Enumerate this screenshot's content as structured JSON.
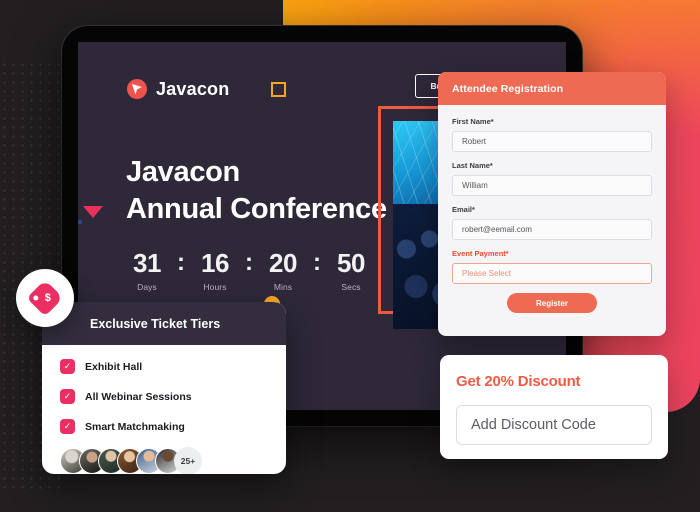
{
  "brand": {
    "name": "Javacon",
    "logo_icon": "javacon-circle-arrow-icon",
    "accent_coral": "#ef6a52",
    "accent_pink": "#ec2f63",
    "accent_orange": "#f5a623",
    "screen_bg": "#2e2839"
  },
  "hero": {
    "buy_tickets_label": "Buy Tickets",
    "title_line1": "Javacon",
    "title_line2": "Annual Conference",
    "countdown": {
      "separator": ":",
      "units": [
        {
          "value": "31",
          "label": "Days"
        },
        {
          "value": "16",
          "label": "Hours"
        },
        {
          "value": "20",
          "label": "Mins"
        },
        {
          "value": "50",
          "label": "Secs"
        }
      ]
    }
  },
  "registration": {
    "heading": "Attendee Registration",
    "fields": [
      {
        "label": "First Name*",
        "value": "Robert",
        "required_accent": false
      },
      {
        "label": "Last Name*",
        "value": "William",
        "required_accent": false
      },
      {
        "label": "Email*",
        "value": "robert@eemail.com",
        "required_accent": false
      }
    ],
    "payment": {
      "label": "Event Payment*",
      "placeholder": "Please Select"
    },
    "submit_label": "Register"
  },
  "ticket_tiers": {
    "heading": "Exclusive Ticket Tiers",
    "badge_icon": "price-tag-dollar-icon",
    "check_glyph": "✓",
    "items": [
      {
        "label": "Exhibit Hall"
      },
      {
        "label": "All Webinar Sessions"
      },
      {
        "label": "Smart Matchmaking"
      }
    ],
    "attendees_more": "25+"
  },
  "discount": {
    "title": "Get 20% Discount",
    "input_placeholder": "Add Discount Code"
  }
}
